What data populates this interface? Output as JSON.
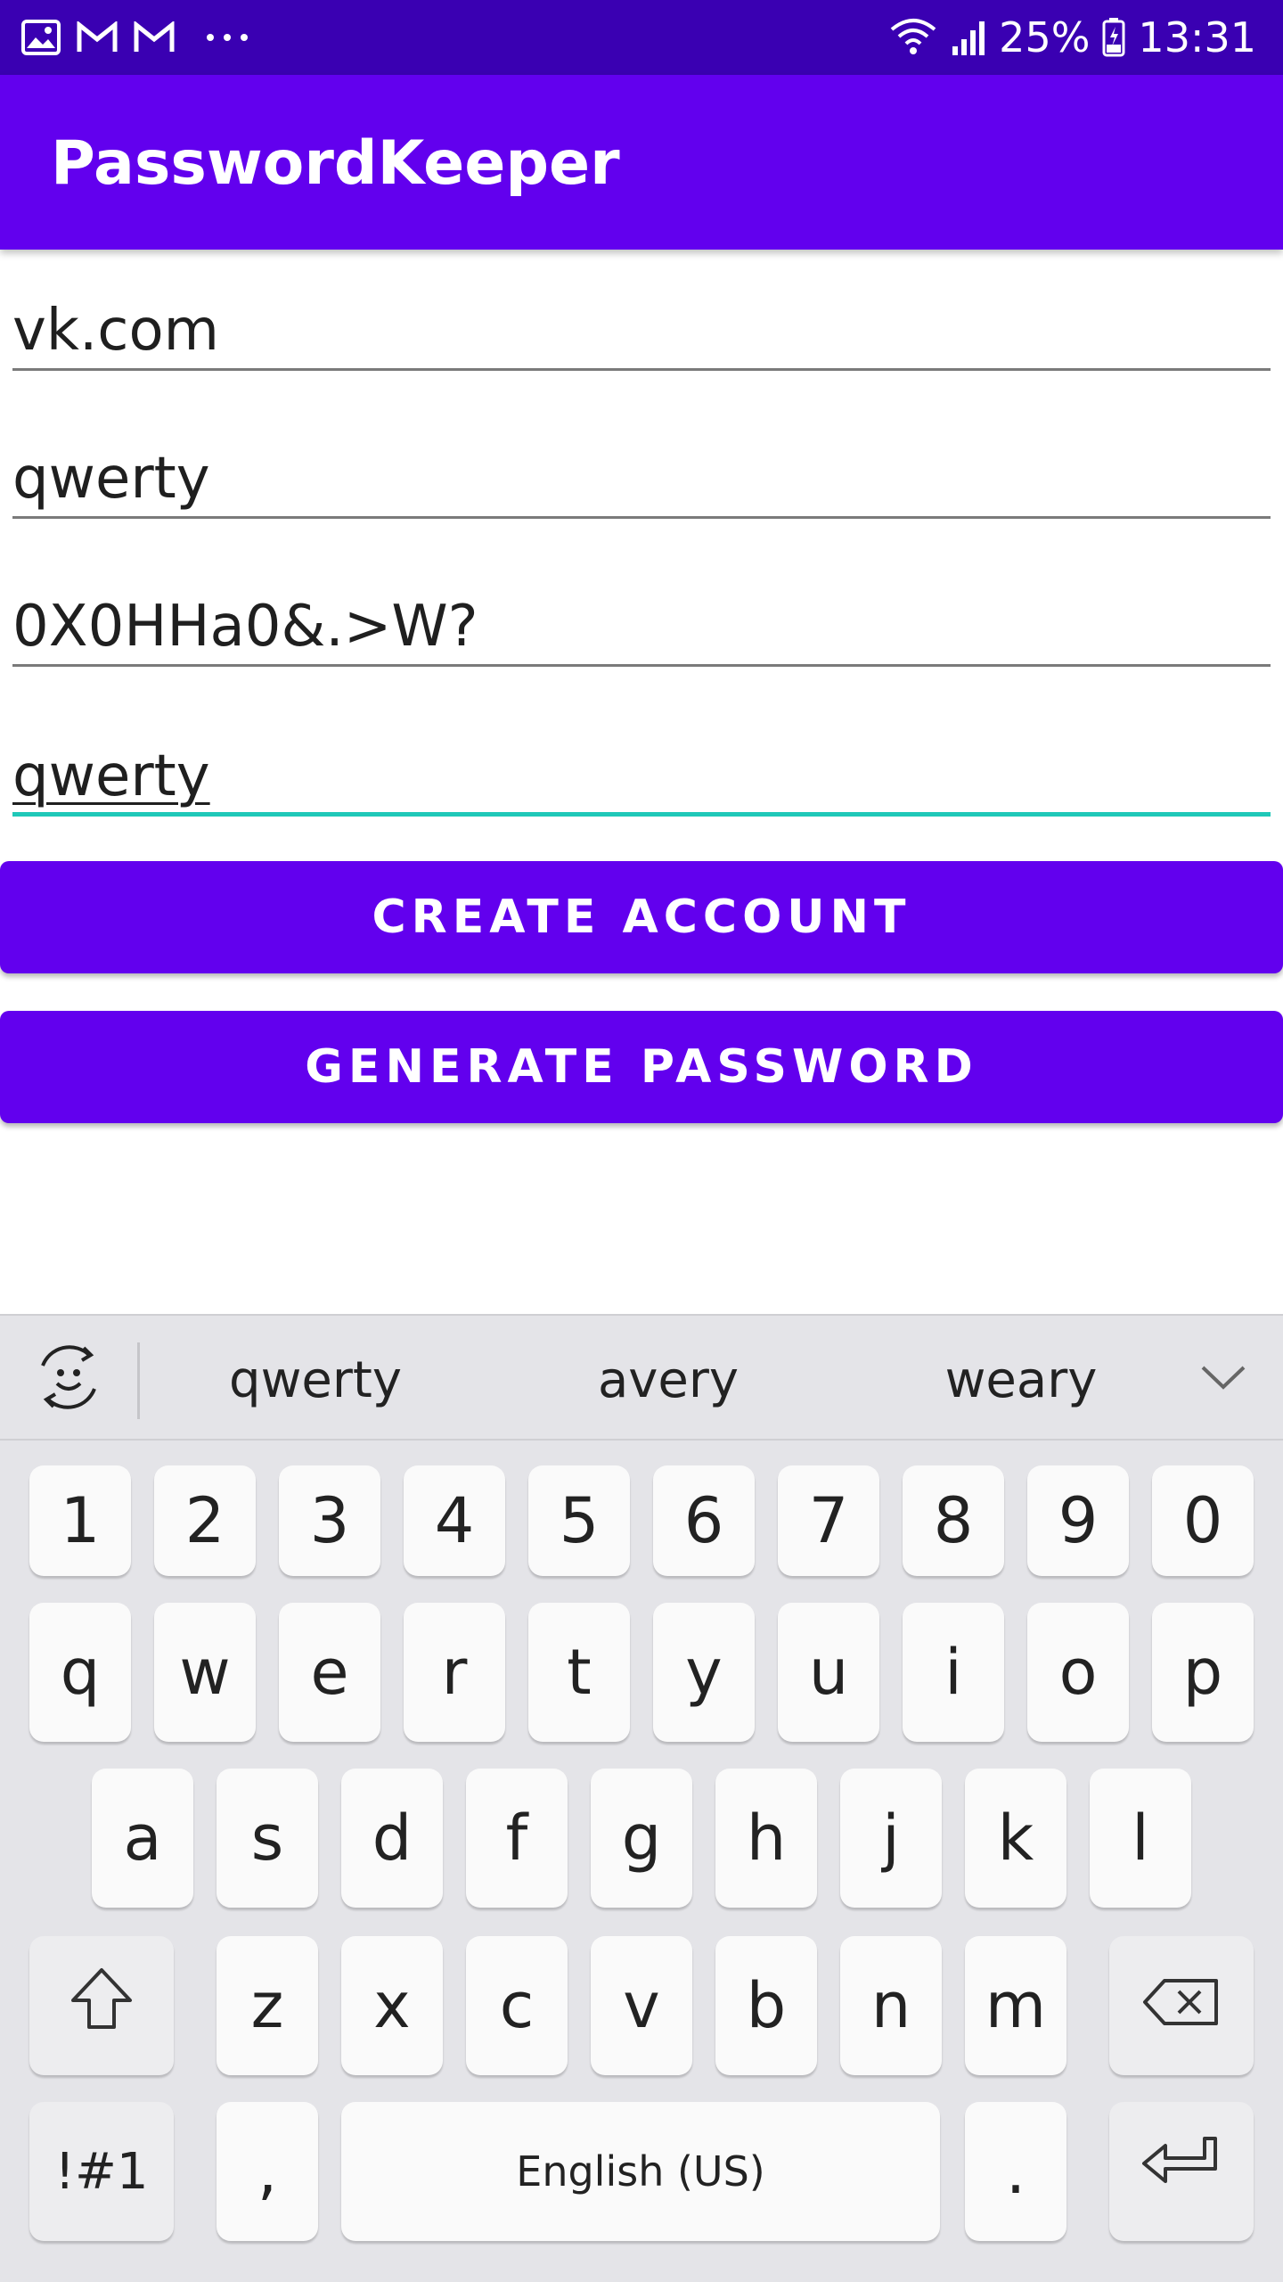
{
  "status_bar": {
    "left_icons": [
      "gallery-icon",
      "gmail-icon",
      "gmail-icon",
      "more-dots-icon"
    ],
    "battery_percent": "25%",
    "time": "13:31",
    "colors": {
      "background": "#3A00B2"
    }
  },
  "app_bar": {
    "title": "PasswordKeeper",
    "color": "#6200EE"
  },
  "form": {
    "site_value": "vk.com",
    "login_value": "qwerty",
    "password_value": "0X0HHa0&.>W?",
    "note_value": "qwerty"
  },
  "buttons": {
    "create_account": "CREATE ACCOUNT",
    "generate_password": "GENERATE PASSWORD"
  },
  "keyboard": {
    "suggestions": [
      "qwerty",
      "avery",
      "weary"
    ],
    "row_numbers": [
      "1",
      "2",
      "3",
      "4",
      "5",
      "6",
      "7",
      "8",
      "9",
      "0"
    ],
    "row1": [
      "q",
      "w",
      "e",
      "r",
      "t",
      "y",
      "u",
      "i",
      "o",
      "p"
    ],
    "row2": [
      "a",
      "s",
      "d",
      "f",
      "g",
      "h",
      "j",
      "k",
      "l"
    ],
    "row3": [
      "z",
      "x",
      "c",
      "v",
      "b",
      "n",
      "m"
    ],
    "symbols_key": "!#1",
    "comma_key": ",",
    "space_key": "English (US)",
    "period_key": "."
  }
}
